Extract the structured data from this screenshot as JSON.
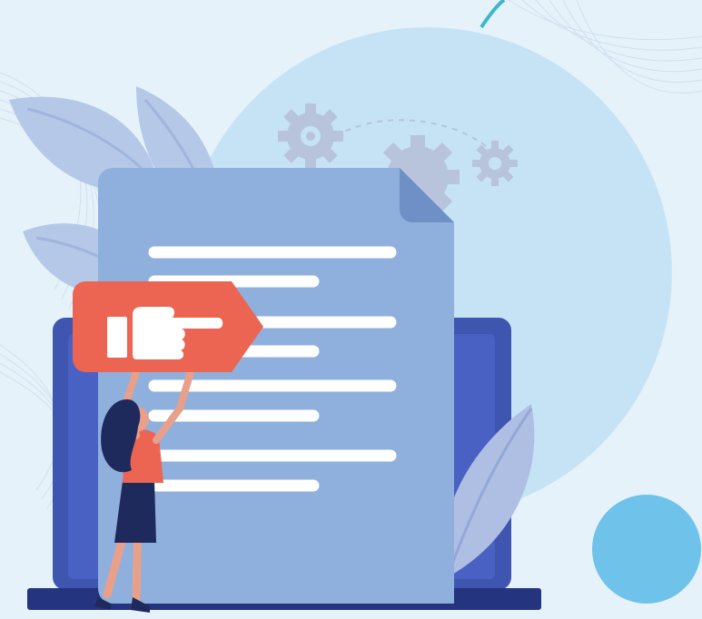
{
  "scene": {
    "colors": {
      "background": "#e6f2fa",
      "big_circle": "#c6e3f5",
      "small_circle": "#6fc2ea",
      "document": "#8fb0dd",
      "document_fold": "#6f8fc7",
      "document_lines": "#ffffff",
      "laptop": "#3f56b0",
      "laptop_screen": "#4a61c4",
      "laptop_base": "#24347e",
      "leaf": "#b5c8e8",
      "gear": "#c9d2e5",
      "pointer_sign": "#ec6452",
      "hand_icon": "#ffffff",
      "woman_hair": "#1f2a5c",
      "woman_top": "#ec6452",
      "woman_skirt": "#1f2a5c",
      "woman_skin": "#e8a08a"
    },
    "icons": [
      "pointing-hand-icon",
      "gear-icon",
      "document-icon",
      "laptop-icon",
      "leaf-icon"
    ]
  }
}
